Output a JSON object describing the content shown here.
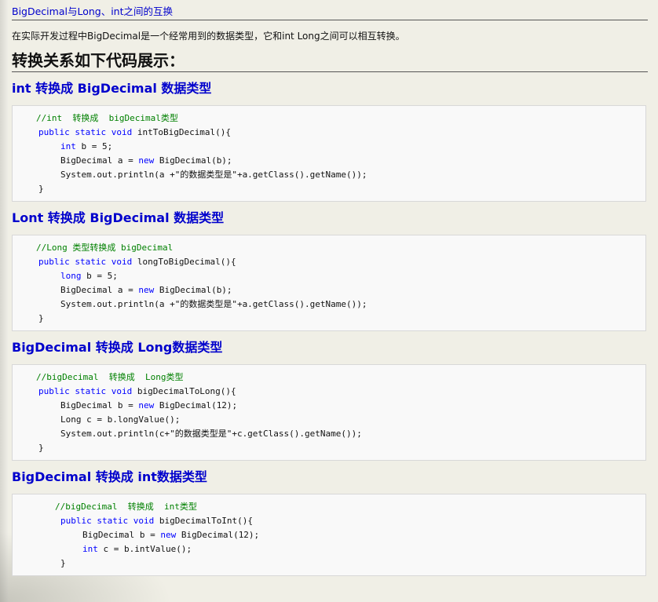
{
  "header": {
    "title_link": "BigDecimal与Long、int之间的互换"
  },
  "intro": "在实际开发过程中BigDecimal是一个经常用到的数据类型，它和int Long之间可以相互转换。",
  "section_heading": "转换关系如下代码展示：",
  "sections": [
    {
      "heading": "int 转换成 BigDecimal 数据类型",
      "code": {
        "comment": "//int  转换成  bigDecimal类型",
        "sig_kw": "public static void",
        "sig_rest": " intToBigDecimal(){",
        "l1_kw": "int",
        "l1_rest": " b = 5;",
        "l2_pre": "BigDecimal a = ",
        "l2_kw": "new",
        "l2_rest": " BigDecimal(b);",
        "l3": "System.out.println(a +\"的数据类型是\"+a.getClass().getName());",
        "close": "}"
      }
    },
    {
      "heading": "Lont 转换成 BigDecimal 数据类型",
      "code": {
        "comment": "//Long 类型转换成 bigDecimal",
        "sig_kw": "public static void",
        "sig_rest": " longToBigDecimal(){",
        "l1_kw": "long",
        "l1_rest": " b = 5;",
        "l2_pre": "BigDecimal a = ",
        "l2_kw": "new",
        "l2_rest": " BigDecimal(b);",
        "l3": "System.out.println(a +\"的数据类型是\"+a.getClass().getName());",
        "close": "}"
      }
    },
    {
      "heading": "BigDecimal 转换成 Long数据类型",
      "code": {
        "comment": "//bigDecimal  转换成  Long类型",
        "sig_kw": "public static void",
        "sig_rest": " bigDecimalToLong(){",
        "l1_pre": "BigDecimal b = ",
        "l1_kw": "new",
        "l1_rest": " BigDecimal(12);",
        "l2": "Long c = b.longValue();",
        "l3": "System.out.println(c+\"的数据类型是\"+c.getClass().getName());",
        "close": "}"
      }
    },
    {
      "heading": "BigDecimal 转换成 int数据类型",
      "code": {
        "comment": "//bigDecimal  转换成  int类型",
        "sig_kw": "public static void",
        "sig_rest": " bigDecimalToInt(){",
        "l1_pre": "BigDecimal b = ",
        "l1_kw": "new",
        "l1_rest": " BigDecimal(12);",
        "l2_kw": "int",
        "l2_rest": " c = b.intValue();",
        "close": "}"
      }
    }
  ]
}
